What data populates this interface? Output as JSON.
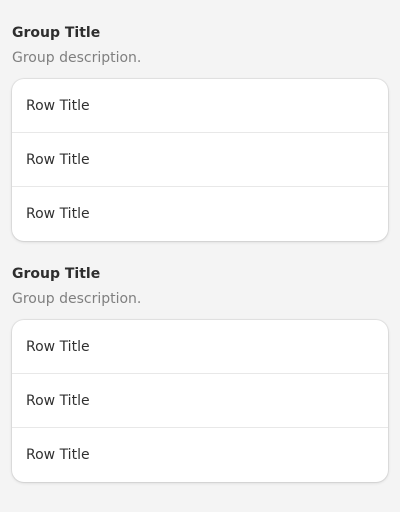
{
  "groups": [
    {
      "title": "Group Title",
      "description": "Group description.",
      "rows": [
        {
          "title": "Row Title"
        },
        {
          "title": "Row Title"
        },
        {
          "title": "Row Title"
        }
      ]
    },
    {
      "title": "Group Title",
      "description": "Group description.",
      "rows": [
        {
          "title": "Row Title"
        },
        {
          "title": "Row Title"
        },
        {
          "title": "Row Title"
        }
      ]
    }
  ]
}
